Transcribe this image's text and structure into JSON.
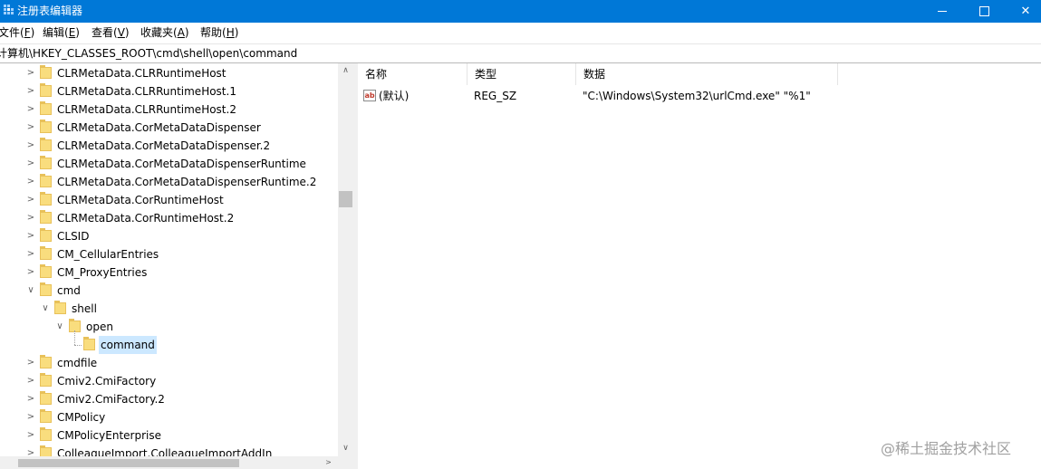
{
  "window": {
    "title": "注册表编辑器",
    "min_glyph": "",
    "max_glyph": "",
    "close_glyph": "✕"
  },
  "menu": [
    {
      "text": "文件(",
      "key": "F",
      "end": ")"
    },
    {
      "text": "编辑(",
      "key": "E",
      "end": ")"
    },
    {
      "text": "查看(",
      "key": "V",
      "end": ")"
    },
    {
      "text": "收藏夹(",
      "key": "A",
      "end": ")"
    },
    {
      "text": "帮助(",
      "key": "H",
      "end": ")"
    }
  ],
  "address": "计算机\\HKEY_CLASSES_ROOT\\cmd\\shell\\open\\command",
  "tree": {
    "items": [
      {
        "label": "CLRMetaData.CLRRuntimeHost",
        "level": 0,
        "expander": "collapsed"
      },
      {
        "label": "CLRMetaData.CLRRuntimeHost.1",
        "level": 0,
        "expander": "collapsed"
      },
      {
        "label": "CLRMetaData.CLRRuntimeHost.2",
        "level": 0,
        "expander": "collapsed"
      },
      {
        "label": "CLRMetaData.CorMetaDataDispenser",
        "level": 0,
        "expander": "collapsed"
      },
      {
        "label": "CLRMetaData.CorMetaDataDispenser.2",
        "level": 0,
        "expander": "collapsed"
      },
      {
        "label": "CLRMetaData.CorMetaDataDispenserRuntime",
        "level": 0,
        "expander": "collapsed"
      },
      {
        "label": "CLRMetaData.CorMetaDataDispenserRuntime.2",
        "level": 0,
        "expander": "collapsed"
      },
      {
        "label": "CLRMetaData.CorRuntimeHost",
        "level": 0,
        "expander": "collapsed"
      },
      {
        "label": "CLRMetaData.CorRuntimeHost.2",
        "level": 0,
        "expander": "collapsed"
      },
      {
        "label": "CLSID",
        "level": 0,
        "expander": "collapsed"
      },
      {
        "label": "CM_CellularEntries",
        "level": 0,
        "expander": "collapsed"
      },
      {
        "label": "CM_ProxyEntries",
        "level": 0,
        "expander": "collapsed"
      },
      {
        "label": "cmd",
        "level": 0,
        "expander": "expanded"
      },
      {
        "label": "shell",
        "level": 1,
        "expander": "expanded"
      },
      {
        "label": "open",
        "level": 2,
        "expander": "expanded"
      },
      {
        "label": "command",
        "level": 3,
        "expander": "none",
        "selected": true
      },
      {
        "label": "cmdfile",
        "level": 0,
        "expander": "collapsed"
      },
      {
        "label": "Cmiv2.CmiFactory",
        "level": 0,
        "expander": "collapsed"
      },
      {
        "label": "Cmiv2.CmiFactory.2",
        "level": 0,
        "expander": "collapsed"
      },
      {
        "label": "CMPolicy",
        "level": 0,
        "expander": "collapsed"
      },
      {
        "label": "CMPolicyEnterprise",
        "level": 0,
        "expander": "collapsed"
      },
      {
        "label": "ColleagueImport.ColleagueImportAddIn",
        "level": 0,
        "expander": "collapsed"
      }
    ]
  },
  "scroll": {
    "up_arrow": "∧",
    "down_arrow": "∨",
    "right_arrow": ">"
  },
  "values": {
    "columns": [
      "名称",
      "类型",
      "数据"
    ],
    "rows": [
      {
        "icon": "ab",
        "name": "(默认)",
        "type": "REG_SZ",
        "data": "\"C:\\Windows\\System32\\urlCmd.exe\" \"%1\""
      }
    ]
  },
  "watermark": "@稀土掘金技术社区",
  "colors": {
    "titlebar": "#0078d7",
    "selection": "#cce8ff",
    "folder": "#f9dd7e"
  }
}
